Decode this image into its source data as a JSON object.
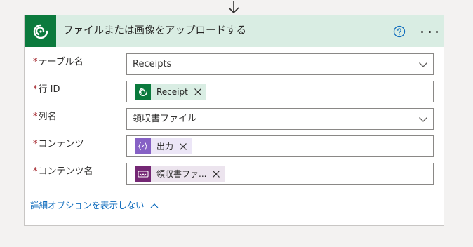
{
  "card": {
    "title": "ファイルまたは画像をアップロードする",
    "app_icon": "dataverse-icon",
    "help_icon": "help-circle-icon",
    "more_icon": "more-ellipsis-icon",
    "accent_color": "#0b7a3d",
    "header_bg": "#d9ede3"
  },
  "fields": {
    "table_name": {
      "required": "*",
      "label": "テーブル名",
      "value": "Receipts"
    },
    "row_id": {
      "required": "*",
      "label": "行 ID",
      "token": {
        "text": "Receipt",
        "icon": "dataverse-icon"
      }
    },
    "column_name": {
      "required": "*",
      "label": "列名",
      "value": "領収書ファイル"
    },
    "content": {
      "required": "*",
      "label": "コンテンツ",
      "token": {
        "text": "出力",
        "icon": "expression-icon"
      }
    },
    "content_name": {
      "required": "*",
      "label": "コンテンツ名",
      "token": {
        "text": "領収書ファ...",
        "icon": "power-apps-icon"
      }
    }
  },
  "advanced_options": {
    "label": "詳細オプションを表示しない"
  },
  "colors": {
    "required": "#a4262c",
    "link": "#0f6cbd",
    "token_green": "#d9ede3",
    "token_purple": "#ece6f7",
    "token_dark_purple": "#ece4ee"
  }
}
